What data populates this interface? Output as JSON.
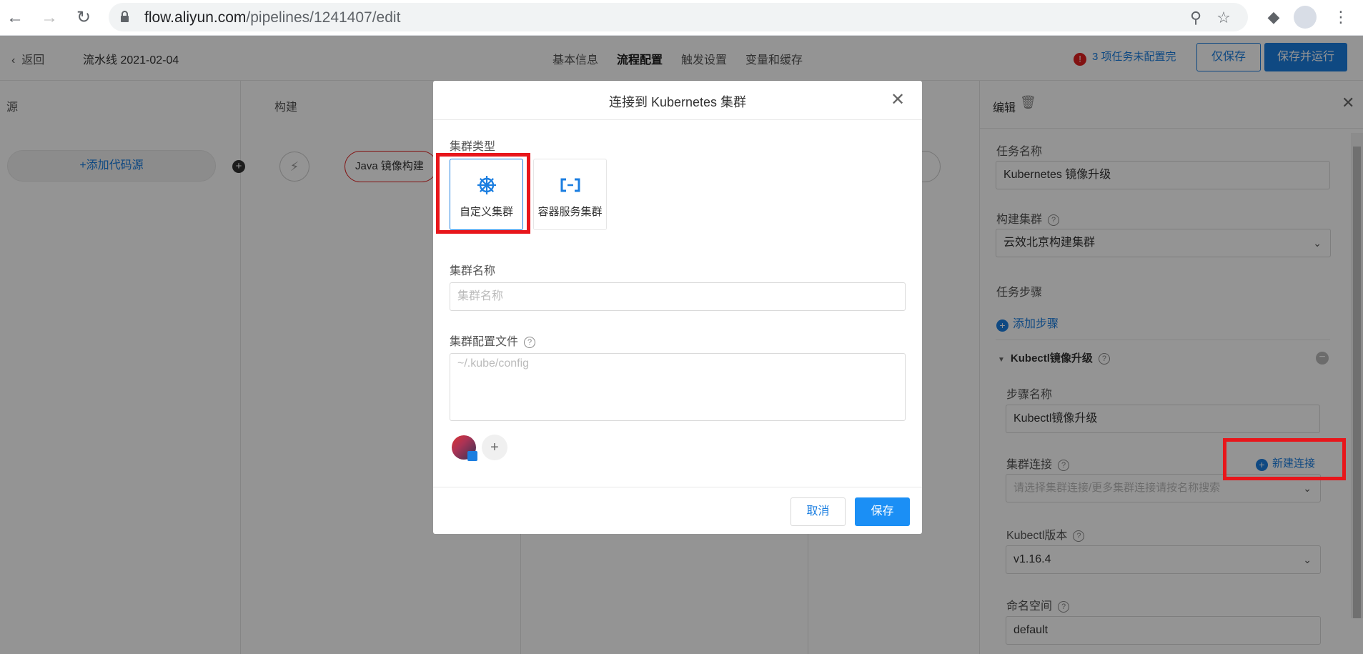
{
  "browser": {
    "url_host": "flow.aliyun.com",
    "url_path": "/pipelines/1241407/edit"
  },
  "topbar": {
    "back_label": "返回",
    "pipeline_name": "流水线 2021-02-04",
    "tabs": [
      {
        "label": "基本信息"
      },
      {
        "label": "流程配置"
      },
      {
        "label": "触发设置"
      },
      {
        "label": "变量和缓存"
      }
    ],
    "warning_icon": "!",
    "warning_text": "3 项任务未配置完",
    "save_only_label": "仅保存",
    "save_run_label": "保存并运行"
  },
  "canvas": {
    "col_source": "源",
    "col_build": "构建",
    "add_source_label": "添加代码源",
    "job_label": "Java 镜像构建"
  },
  "right_panel": {
    "title": "编辑",
    "task_name_label": "任务名称",
    "task_name_value": "Kubernetes 镜像升级",
    "build_cluster_label": "构建集群",
    "build_cluster_value": "云效北京构建集群",
    "task_steps_label": "任务步骤",
    "add_step_label": "添加步骤",
    "step_title": "Kubectl镜像升级",
    "step_name_label": "步骤名称",
    "step_name_value": "Kubectl镜像升级",
    "cluster_conn_label": "集群连接",
    "new_conn_label": "新建连接",
    "cluster_conn_placeholder": "请选择集群连接/更多集群连接请按名称搜索",
    "kubectl_version_label": "Kubectl版本",
    "kubectl_version_value": "v1.16.4",
    "namespace_label": "命名空间",
    "namespace_value": "default"
  },
  "modal": {
    "title": "连接到 Kubernetes 集群",
    "cluster_type_label": "集群类型",
    "types": [
      {
        "label": "自定义集群",
        "icon": "helm-wheel-icon"
      },
      {
        "label": "容器服务集群",
        "icon": "aliyun-bracket-icon"
      }
    ],
    "cluster_name_label": "集群名称",
    "cluster_name_placeholder": "集群名称",
    "config_label": "集群配置文件",
    "config_placeholder": "~/.kube/config",
    "cancel_label": "取消",
    "save_label": "保存"
  }
}
